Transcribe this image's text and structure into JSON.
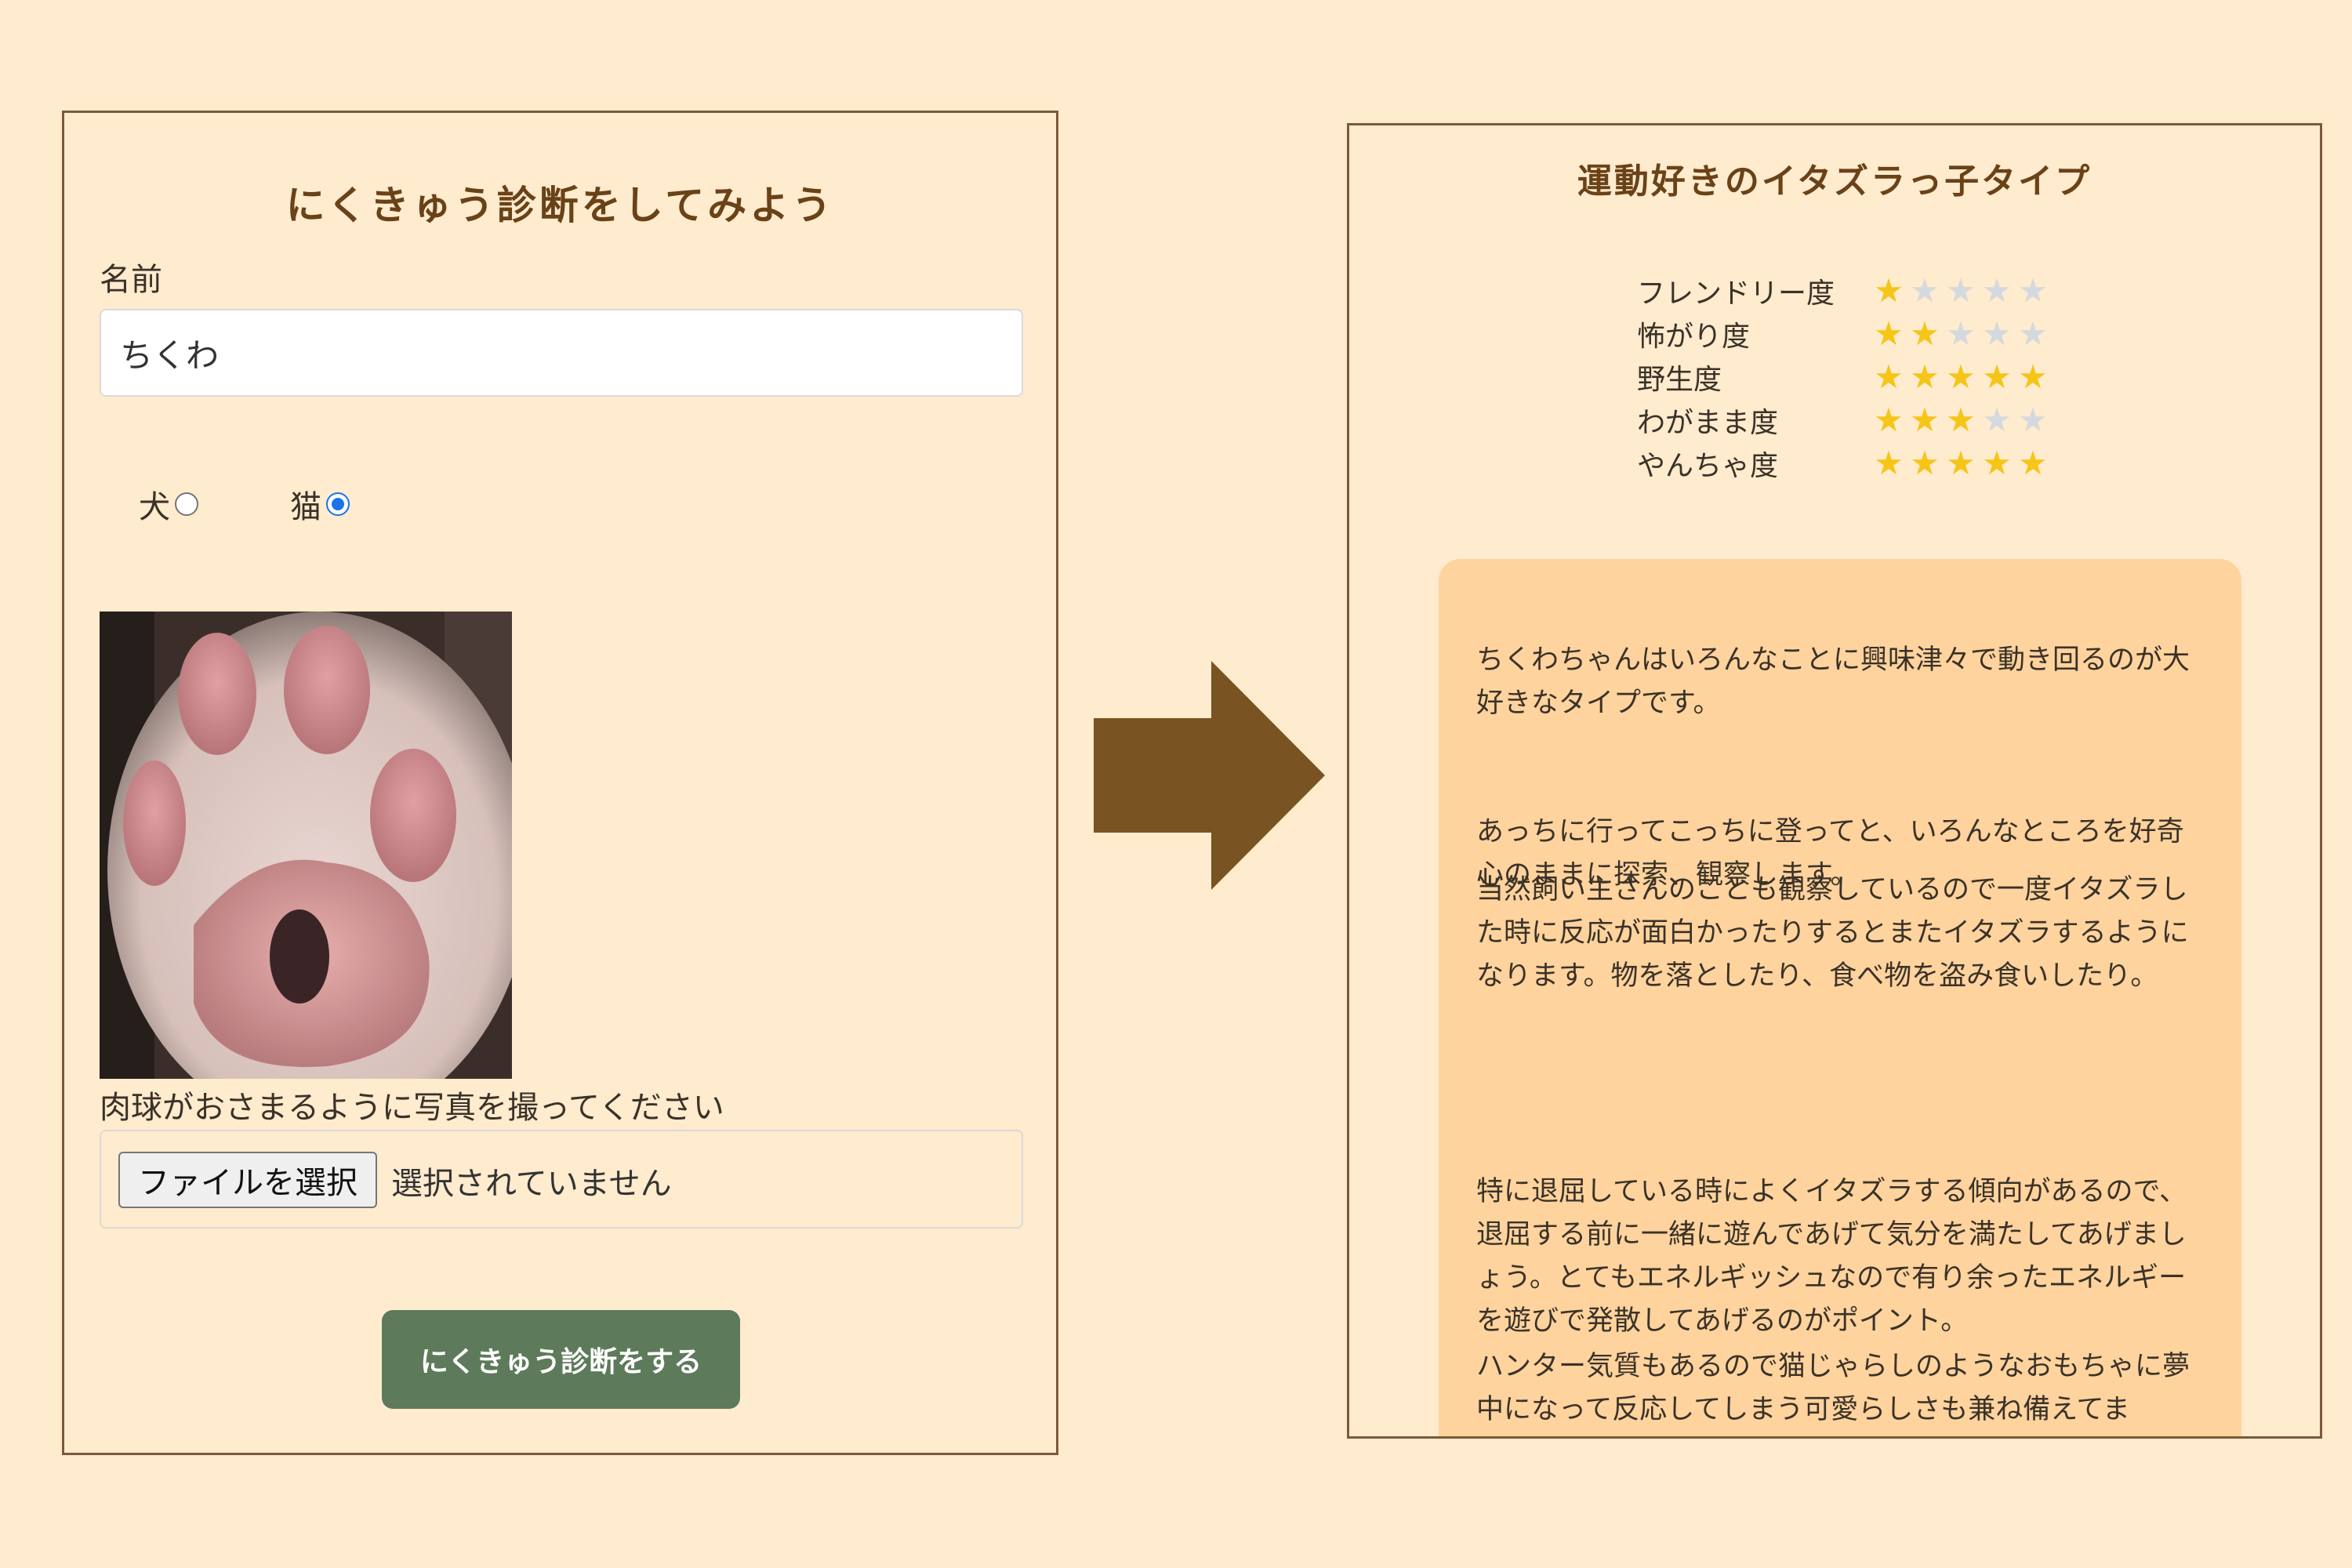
{
  "form": {
    "title": "にくきゅう診断をしてみよう",
    "name_label": "名前",
    "name_value": "ちくわ",
    "radio_dog": "犬",
    "radio_cat": "猫",
    "selected": "猫",
    "photo_caption": "肉球がおさまるように写真を撮ってください",
    "file_button": "ファイルを選択",
    "file_status": "選択されていません",
    "submit": "にくきゅう診断をする"
  },
  "arrow": {
    "color": "#7A5322",
    "icon": "right-arrow-icon"
  },
  "result": {
    "title": "運動好きのイタズラっ子タイプ",
    "ratings": [
      {
        "label": "フレンドリー度",
        "stars": 1
      },
      {
        "label": "怖がり度",
        "stars": 2
      },
      {
        "label": "野生度",
        "stars": 5
      },
      {
        "label": "わがまま度",
        "stars": 3
      },
      {
        "label": "やんちゃ度",
        "stars": 5
      }
    ],
    "star_max": 5,
    "star_on_color": "#F5C518",
    "star_off_color": "#D4D9DF",
    "paragraphs": [
      "ちくわちゃんはいろんなことに興味津々で動き回るのが大好きなタイプです。",
      "あっちに行ってこっちに登ってと、いろんなところを好奇心のままに探索、観察します。",
      "当然飼い主さんのことも観察しているので一度イタズラした時に反応が面白かったりするとまたイタズラするようになります。物を落としたり、食べ物を盗み食いしたり。",
      "特に退屈している時によくイタズラする傾向があるので、退屈する前に一緒に遊んであげて気分を満たしてあげましょう。とてもエネルギッシュなので有り余ったエネルギーを遊びで発散してあげるのがポイント。",
      "ハンター気質もあるので猫じゃらしのようなおもちゃに夢中になって反応してしまう可愛らしさも兼ね備えてま"
    ]
  },
  "colors": {
    "background": "#FFEBCE",
    "panel_border": "#7A5A3A",
    "title_brown": "#6A4218",
    "button_green": "#5D7A5B",
    "desc_box": "#FFD39E"
  }
}
